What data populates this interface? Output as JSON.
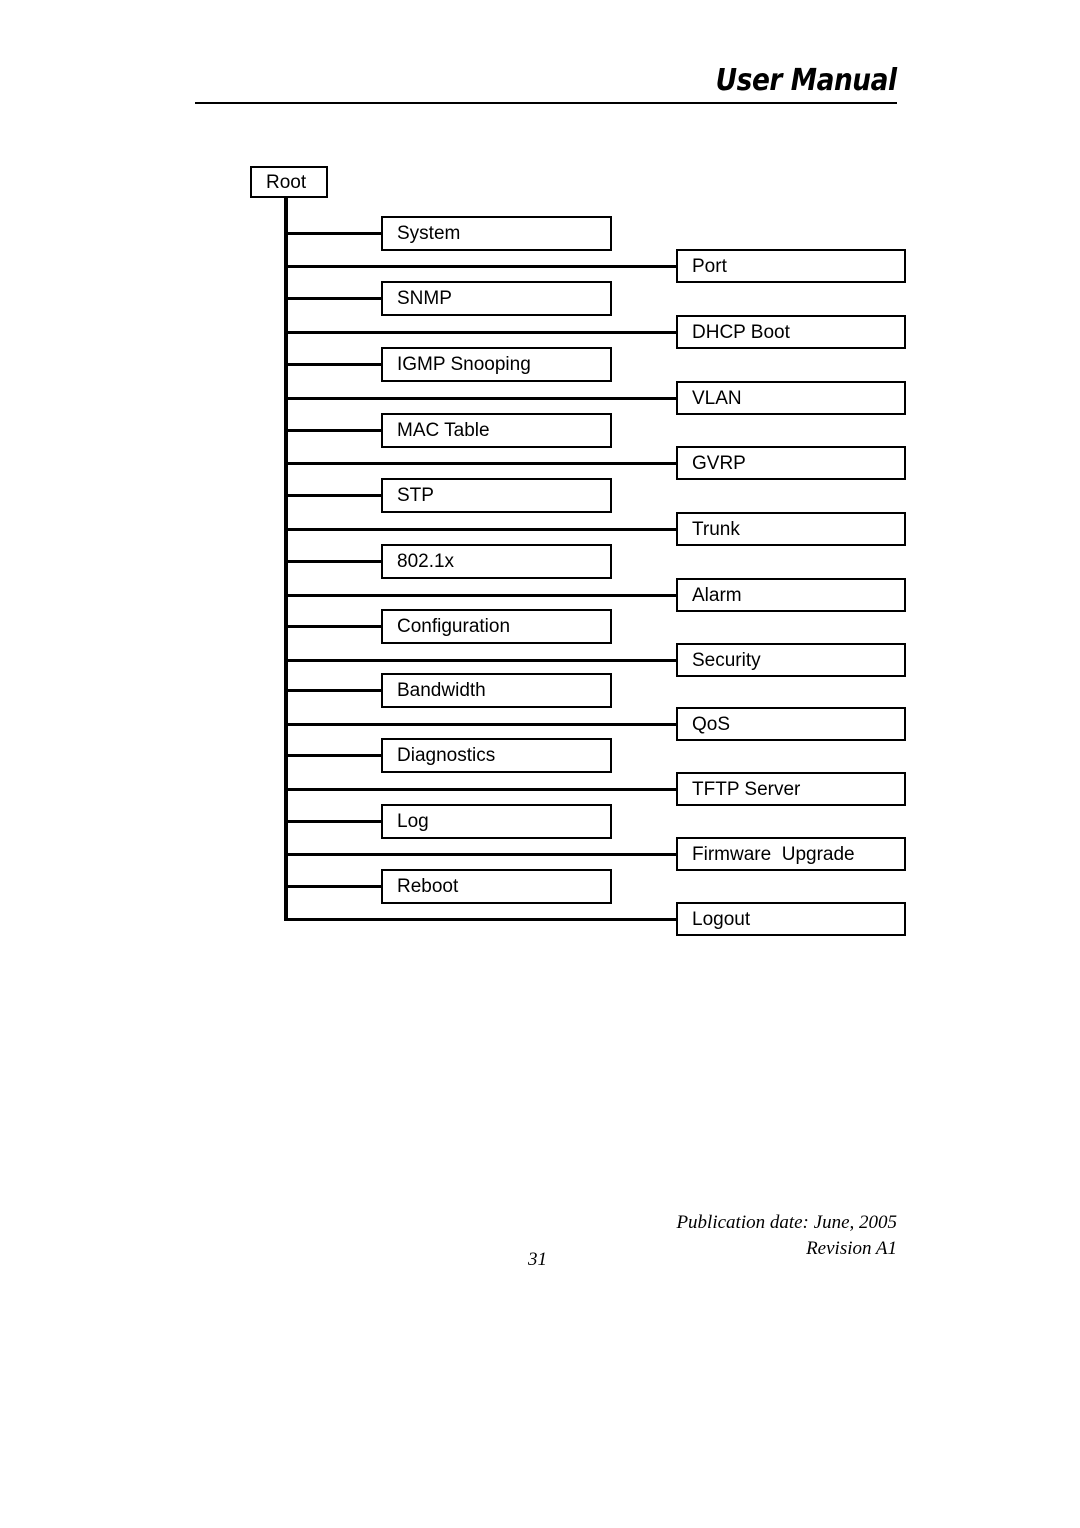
{
  "header": {
    "title": "User Manual"
  },
  "diagram": {
    "root": {
      "label": "Root"
    },
    "left_column": [
      {
        "label": "System"
      },
      {
        "label": "SNMP"
      },
      {
        "label": "IGMP Snooping"
      },
      {
        "label": "MAC Table"
      },
      {
        "label": "STP"
      },
      {
        "label": "802.1x"
      },
      {
        "label": "Configuration"
      },
      {
        "label": "Bandwidth"
      },
      {
        "label": "Diagnostics"
      },
      {
        "label": "Log"
      },
      {
        "label": "Reboot"
      }
    ],
    "right_column": [
      {
        "label": "Port"
      },
      {
        "label": "DHCP Boot"
      },
      {
        "label": "VLAN"
      },
      {
        "label": "GVRP"
      },
      {
        "label": "Trunk"
      },
      {
        "label": "Alarm"
      },
      {
        "label": "Security"
      },
      {
        "label": "QoS"
      },
      {
        "label": "TFTP Server"
      },
      {
        "label": "Firmware  Upgrade"
      },
      {
        "label": "Logout"
      }
    ]
  },
  "footer": {
    "publication_date": "Publication date: June, 2005",
    "revision": "Revision A1",
    "page_number": "31"
  },
  "layout": {
    "left_tops": [
      216,
      281,
      347,
      413,
      478,
      544,
      609,
      673,
      738,
      804,
      869
    ],
    "right_tops": [
      249,
      315,
      381,
      446,
      512,
      578,
      643,
      707,
      772,
      837,
      902
    ],
    "left_branch_tops": [
      232,
      297,
      363,
      429,
      494,
      560,
      625,
      689,
      754,
      820,
      885
    ],
    "right_branch_tops": [
      265,
      331,
      397,
      462,
      528,
      594,
      659,
      723,
      788,
      853,
      918
    ]
  },
  "colors": {
    "ink": "#000000",
    "paper": "#ffffff"
  }
}
